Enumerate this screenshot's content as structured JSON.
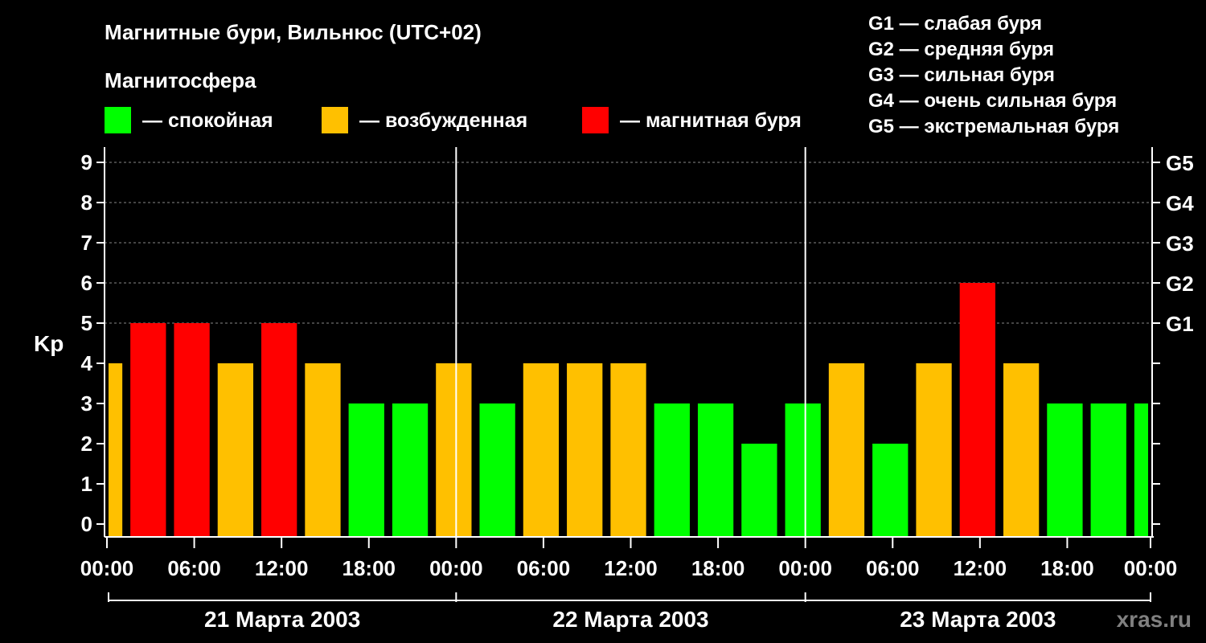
{
  "chart_data": {
    "type": "bar",
    "title": "Магнитные бури, Вильнюс (UTC+02)",
    "subtitle": "Магнитосфера",
    "ylabel": "Kp",
    "ylim": [
      0,
      9
    ],
    "yticks": [
      "0",
      "1",
      "2",
      "3",
      "4",
      "5",
      "6",
      "7",
      "8",
      "9"
    ],
    "xticks": [
      "00:00",
      "06:00",
      "12:00",
      "18:00",
      "00:00",
      "06:00",
      "12:00",
      "18:00",
      "00:00",
      "06:00",
      "12:00",
      "18:00",
      "00:00"
    ],
    "days": [
      "21 Марта 2003",
      "22 Марта 2003",
      "23 Марта 2003"
    ],
    "g_axis": [
      "G1",
      "G2",
      "G3",
      "G4",
      "G5"
    ],
    "legend": [
      {
        "label": "— спокойная",
        "color": "#00ff00"
      },
      {
        "label": "— возбужденная",
        "color": "#ffc000"
      },
      {
        "label": "— магнитная буря",
        "color": "#ff0000"
      }
    ],
    "g_legend": [
      "G1 — слабая буря",
      "G2 — средняя буря",
      "G3 — сильная буря",
      "G4 — очень сильная буря",
      "G5 — экстремальная буря"
    ],
    "colors": {
      "quiet": "#00ff00",
      "unsettled": "#ffc000",
      "storm": "#ff0000"
    },
    "x": [
      "21 Марта 2003 00:00",
      "21 Марта 2003 03:00",
      "21 Марта 2003 06:00",
      "21 Марта 2003 09:00",
      "21 Марта 2003 12:00",
      "21 Марта 2003 15:00",
      "21 Марта 2003 18:00",
      "21 Марта 2003 21:00",
      "22 Марта 2003 00:00",
      "22 Марта 2003 03:00",
      "22 Марта 2003 06:00",
      "22 Марта 2003 09:00",
      "22 Марта 2003 12:00",
      "22 Марта 2003 15:00",
      "22 Марта 2003 18:00",
      "22 Марта 2003 21:00",
      "23 Марта 2003 00:00",
      "23 Марта 2003 03:00",
      "23 Марта 2003 06:00",
      "23 Марта 2003 09:00",
      "23 Марта 2003 12:00",
      "23 Марта 2003 15:00",
      "23 Марта 2003 18:00",
      "23 Марта 2003 21:00",
      "24 Марта 2003 00:00"
    ],
    "values": [
      4,
      5,
      5,
      4,
      5,
      4,
      3,
      3,
      4,
      3,
      4,
      4,
      4,
      3,
      3,
      2,
      3,
      4,
      2,
      4,
      6,
      4,
      3,
      3,
      3
    ],
    "categories": [
      "quiet",
      "unsettled",
      "storm"
    ]
  },
  "watermark": "xras.ru"
}
